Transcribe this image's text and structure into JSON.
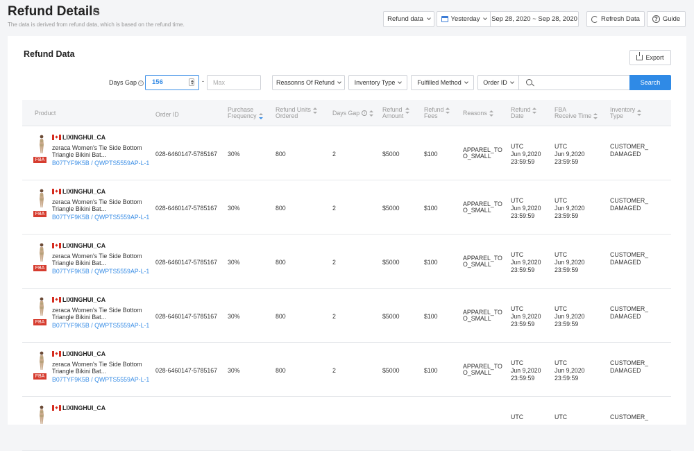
{
  "header": {
    "title": "Refund Details",
    "subtitle": "The data is derived from refund data, which is based on the refund time.",
    "refund_data_label": "Refund data",
    "date_preset": "Yesterday",
    "date_range": "Sep 28, 2020 ~ Sep 28, 2020",
    "refresh_label": "Refresh Data",
    "guide_label": "Guide"
  },
  "card": {
    "title": "Refund Data",
    "export_label": "Export"
  },
  "filters": {
    "days_gap_label": "Days Gap",
    "days_gap_min": "156",
    "days_gap_max_placeholder": "Max",
    "reasons_label": "Reasonns Of Refund",
    "inventory_type_label": "Inventory Type",
    "fulfilled_method_label": "Fulfilled Method",
    "order_id_label": "Order ID",
    "search_label": "Search"
  },
  "columns": {
    "product": "Product",
    "order_id": "Order ID",
    "purchase_frequency_1": "Purchase",
    "purchase_frequency_2": "Frequency",
    "refund_units_1": "Refund Units",
    "refund_units_2": "Ordered",
    "days_gap": "Days Gap",
    "refund_amount_1": "Refund",
    "refund_amount_2": "Amount",
    "refund_fees_1": "Refund",
    "refund_fees_2": "Fees",
    "reasons": "Reasons",
    "refund_date_1": "Refund",
    "refund_date_2": "Date",
    "fba_receive_1": "FBA",
    "fba_receive_2": "Receive Time",
    "inventory_type_1": "Inventory",
    "inventory_type_2": "Type"
  },
  "rows": [
    {
      "store": "LIXINGHUI_CA",
      "name1": "zeraca Women's Tie Side Bottom",
      "name2": "Triangle Bikini Bat...",
      "badge": "FBA",
      "asin": "B07TYF9K5B / QWPTS5559AP-L-1",
      "order_id": "028-6460147-5785167",
      "freq": "30%",
      "units": "800",
      "gap": "2",
      "amount": "$5000",
      "fees": "$100",
      "reason1": "APPAREL_TO",
      "reason2": "O_SMALL",
      "rd1": "UTC",
      "rd2": "Jun 9,2020",
      "rd3": "23:59:59",
      "fr1": "UTC",
      "fr2": "Jun 9,2020",
      "fr3": "23:59:59",
      "inv1": "CUSTOMER_",
      "inv2": "DAMAGED"
    },
    {
      "store": "LIXINGHUI_CA",
      "name1": "zeraca Women's Tie Side Bottom",
      "name2": "Triangle Bikini Bat...",
      "badge": "FBA",
      "asin": "B07TYF9K5B / QWPTS5559AP-L-1",
      "order_id": "028-6460147-5785167",
      "freq": "30%",
      "units": "800",
      "gap": "2",
      "amount": "$5000",
      "fees": "$100",
      "reason1": "APPAREL_TO",
      "reason2": "O_SMALL",
      "rd1": "UTC",
      "rd2": "Jun 9,2020",
      "rd3": "23:59:59",
      "fr1": "UTC",
      "fr2": "Jun 9,2020",
      "fr3": "23:59:59",
      "inv1": "CUSTOMER_",
      "inv2": "DAMAGED"
    },
    {
      "store": "LIXINGHUI_CA",
      "name1": "zeraca Women's Tie Side Bottom",
      "name2": "Triangle Bikini Bat...",
      "badge": "FBA",
      "asin": "B07TYF9K5B / QWPTS5559AP-L-1",
      "order_id": "028-6460147-5785167",
      "freq": "30%",
      "units": "800",
      "gap": "2",
      "amount": "$5000",
      "fees": "$100",
      "reason1": "APPAREL_TO",
      "reason2": "O_SMALL",
      "rd1": "UTC",
      "rd2": "Jun 9,2020",
      "rd3": "23:59:59",
      "fr1": "UTC",
      "fr2": "Jun 9,2020",
      "fr3": "23:59:59",
      "inv1": "CUSTOMER_",
      "inv2": "DAMAGED"
    },
    {
      "store": "LIXINGHUI_CA",
      "name1": "zeraca Women's Tie Side Bottom",
      "name2": "Triangle Bikini Bat...",
      "badge": "FBA",
      "asin": "B07TYF9K5B / QWPTS5559AP-L-1",
      "order_id": "028-6460147-5785167",
      "freq": "30%",
      "units": "800",
      "gap": "2",
      "amount": "$5000",
      "fees": "$100",
      "reason1": "APPAREL_TO",
      "reason2": "O_SMALL",
      "rd1": "UTC",
      "rd2": "Jun 9,2020",
      "rd3": "23:59:59",
      "fr1": "UTC",
      "fr2": "Jun 9,2020",
      "fr3": "23:59:59",
      "inv1": "CUSTOMER_",
      "inv2": "DAMAGED"
    },
    {
      "store": "LIXINGHUI_CA",
      "name1": "zeraca Women's Tie Side Bottom",
      "name2": "Triangle Bikini Bat...",
      "badge": "FBA",
      "asin": "B07TYF9K5B / QWPTS5559AP-L-1",
      "order_id": "028-6460147-5785167",
      "freq": "30%",
      "units": "800",
      "gap": "2",
      "amount": "$5000",
      "fees": "$100",
      "reason1": "APPAREL_TO",
      "reason2": "O_SMALL",
      "rd1": "UTC",
      "rd2": "Jun 9,2020",
      "rd3": "23:59:59",
      "fr1": "UTC",
      "fr2": "Jun 9,2020",
      "fr3": "23:59:59",
      "inv1": "CUSTOMER_",
      "inv2": "DAMAGED"
    },
    {
      "store": "LIXINGHUI_CA",
      "rd1": "UTC",
      "fr1": "UTC",
      "inv1": "CUSTOMER_"
    }
  ]
}
